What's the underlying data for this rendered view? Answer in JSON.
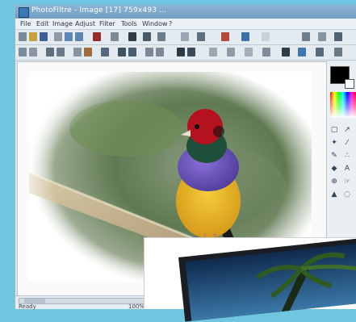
{
  "window": {
    "title": "PhotoFiltre - Image [17] 759x493 …",
    "menu": [
      "File",
      "Edit",
      "Image",
      "Adjust",
      "Filter",
      "Tools",
      "Window",
      "?"
    ]
  },
  "colors": {
    "desktop": "#6ec6e0",
    "foreground": "#000000",
    "background": "#ffffff"
  },
  "toolbar_icons": [
    "new-icon",
    "open-icon",
    "save-icon",
    "print-icon",
    "undo-icon",
    "redo-icon",
    "cut-icon",
    "copy-icon",
    "paste-icon",
    "zoom-in-icon",
    "zoom-out-icon",
    "brightness-icon",
    "contrast-icon"
  ],
  "palette_tools": [
    "select-tool-icon",
    "lasso-tool-icon",
    "magic-wand-icon",
    "pipette-icon",
    "brush-icon",
    "spray-icon",
    "fill-icon",
    "text-icon",
    "clone-icon",
    "smudge-icon",
    "eraser-icon",
    "blur-icon"
  ],
  "status": {
    "text": "Ready",
    "zoom": "100%"
  }
}
